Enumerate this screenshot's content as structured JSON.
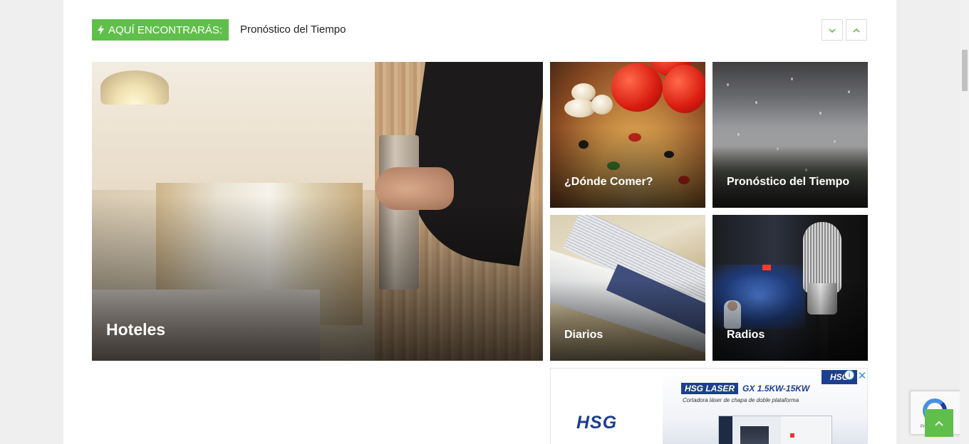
{
  "ticker": {
    "label": "AQUÍ ENCONTRARÁS:",
    "headline": "Pronóstico del Tiempo",
    "label_icon": "bolt-icon",
    "prev_icon": "chevron-down-icon",
    "next_icon": "chevron-up-icon"
  },
  "tiles": {
    "hoteles": "Hoteles",
    "donde_comer": "¿Dónde Comer?",
    "pronostico": "Pronóstico del Tiempo",
    "diarios": "Diarios",
    "radios": "Radios"
  },
  "ad": {
    "logo": "HSG",
    "badge": "HSG",
    "tag": "HSG LASER",
    "model": "GX 1.5KW-15KW",
    "subtitle": "Cortadora láser de chapa de doble plataforma",
    "info_icon": "info-icon",
    "close_icon": "close-icon"
  },
  "recaptcha": {
    "text": "Privacidad"
  },
  "scroll_top_icon": "chevron-up-icon",
  "colors": {
    "accent": "#5fbf4a",
    "ad_brand": "#1d3f8f"
  }
}
